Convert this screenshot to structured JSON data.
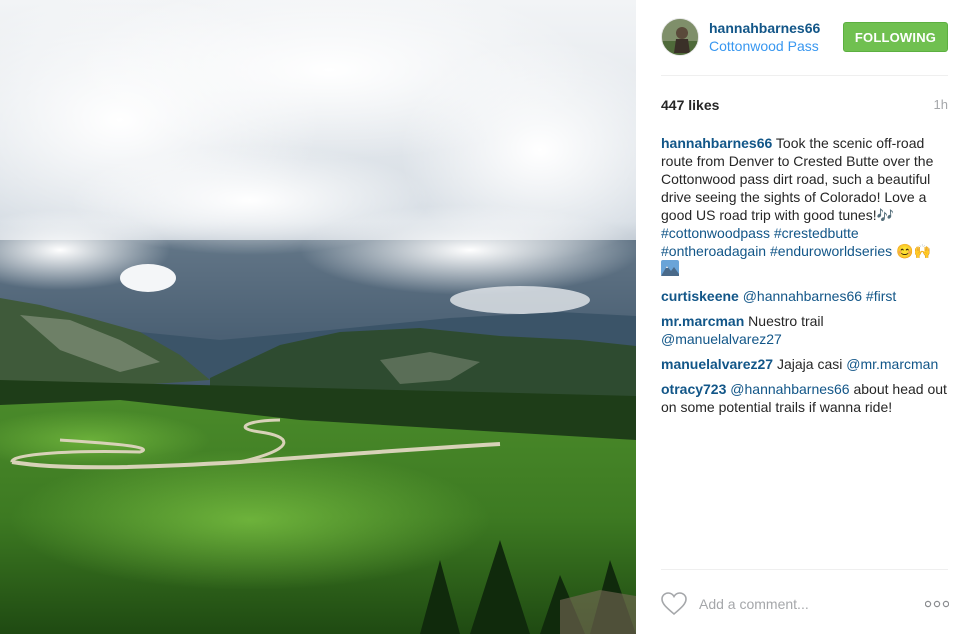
{
  "post": {
    "username": "hannahbarnes66",
    "location": "Cottonwood Pass",
    "follow_label": "FOLLOWING",
    "likes": "447 likes",
    "time": "1h",
    "caption": {
      "user": "hannahbarnes66",
      "text": "Took the scenic off-road route from Denver to Crested Butte over the Cottonwood pass dirt road, such a beautiful drive seeing the sights of Colorado! Love a good US road trip with good tunes!",
      "music_emoji": "🎶",
      "tags": [
        "#cottonwoodpass",
        "#crestedbutte",
        "#ontheroadagain",
        "#enduroworldseries"
      ],
      "emojis": "😊🙌"
    }
  },
  "comments": [
    {
      "user": "curtiskeene",
      "mention": "@hannahbarnes66",
      "tag": "#first"
    },
    {
      "user": "mr.marcman",
      "text": "Nuestro trail",
      "mention": "@manuelalvarez27"
    },
    {
      "user": "manuelalvarez27",
      "text": "Jajaja casi",
      "mention": "@mr.marcman"
    },
    {
      "user": "otracy723",
      "mention": "@hannahbarnes66",
      "text": "about head out on some potential trails if wanna ride!"
    }
  ],
  "footer": {
    "placeholder": "Add a comment...",
    "more_icon": "ellipsis-icon",
    "like_icon": "heart-icon"
  },
  "colors": {
    "username": "#125688",
    "location": "#3897f0",
    "follow": "#70c050",
    "muted": "#a5a7aa"
  }
}
